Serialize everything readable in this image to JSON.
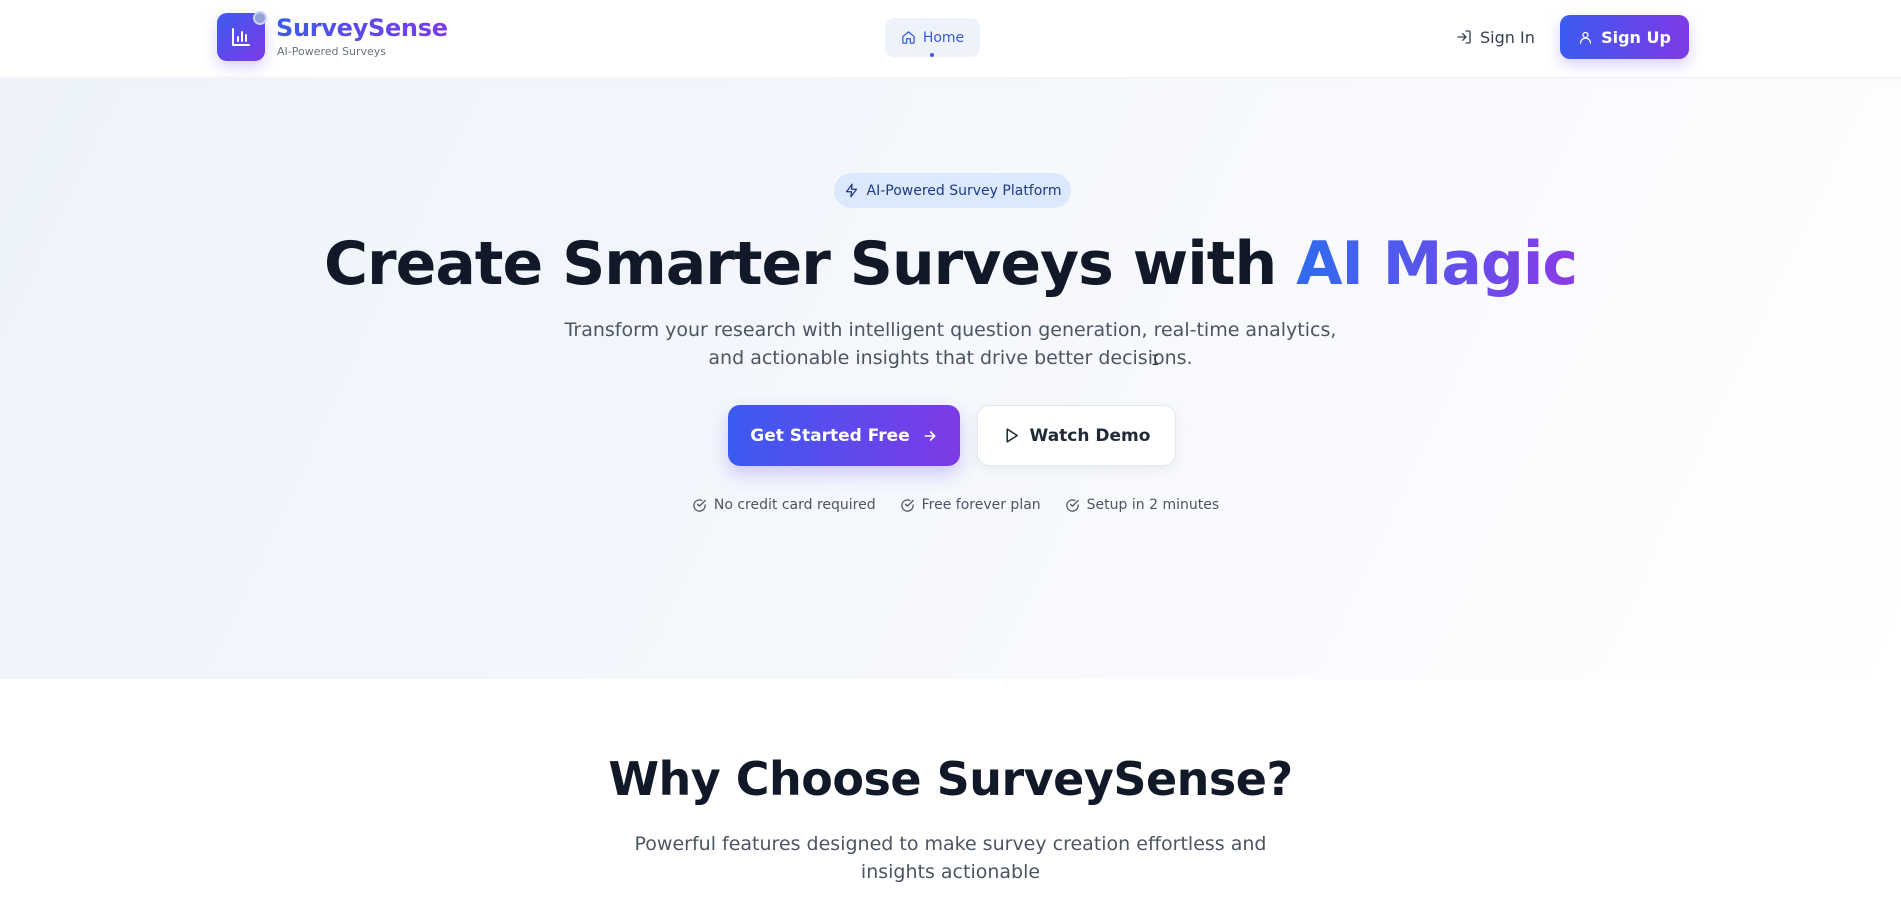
{
  "header": {
    "brand_name": "SurveySense",
    "brand_tagline": "AI-Powered Surveys",
    "nav": {
      "home_label": "Home"
    },
    "sign_in_label": "Sign In",
    "sign_up_label": "Sign Up"
  },
  "hero": {
    "badge_label": "AI-Powered Survey Platform",
    "title_main": "Create Smarter Surveys with ",
    "title_accent": "AI Magic",
    "subtitle": "Transform your research with intelligent question generation, real-time analytics, and actionable insights that drive better decisions.",
    "primary_cta": "Get Started Free",
    "secondary_cta": "Watch Demo",
    "perks": [
      "No credit card required",
      "Free forever plan",
      "Setup in 2 minutes"
    ]
  },
  "features": {
    "title": "Why Choose SurveySense?",
    "subtitle": "Powerful features designed to make survey creation effortless and insights actionable"
  },
  "colors": {
    "brand_start": "#3b5bf0",
    "brand_end": "#7e3ae6",
    "text_dark": "#111827",
    "text_muted": "#4b5563",
    "badge_bg": "#dce8fb"
  },
  "icons": {
    "logo": "bar-chart-icon",
    "home": "home-icon",
    "sign_in": "log-in-icon",
    "sign_up": "user-icon",
    "badge": "zap-icon",
    "primary_cta": "arrow-right-icon",
    "secondary_cta": "play-icon",
    "perk": "check-circle-icon"
  }
}
